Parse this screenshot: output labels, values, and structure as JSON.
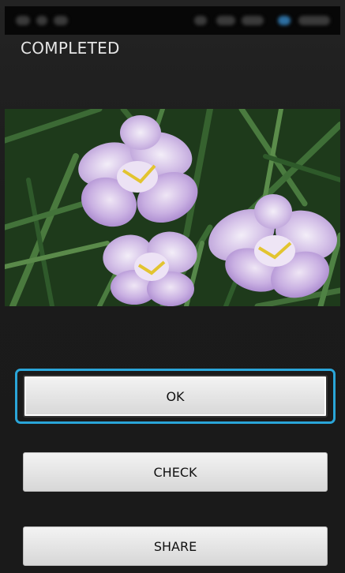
{
  "screen": {
    "title": "COMPLETED"
  },
  "photo": {
    "subject": "purple-white-iris-flowers"
  },
  "buttons": {
    "ok_label": "OK",
    "check_label": "CHECK",
    "share_label": "SHARE"
  },
  "colors": {
    "background": "#1d1d1d",
    "focus_ring": "#2aa5d8",
    "button_face": "#e4e4e4",
    "title_text": "#e6e6e6"
  }
}
